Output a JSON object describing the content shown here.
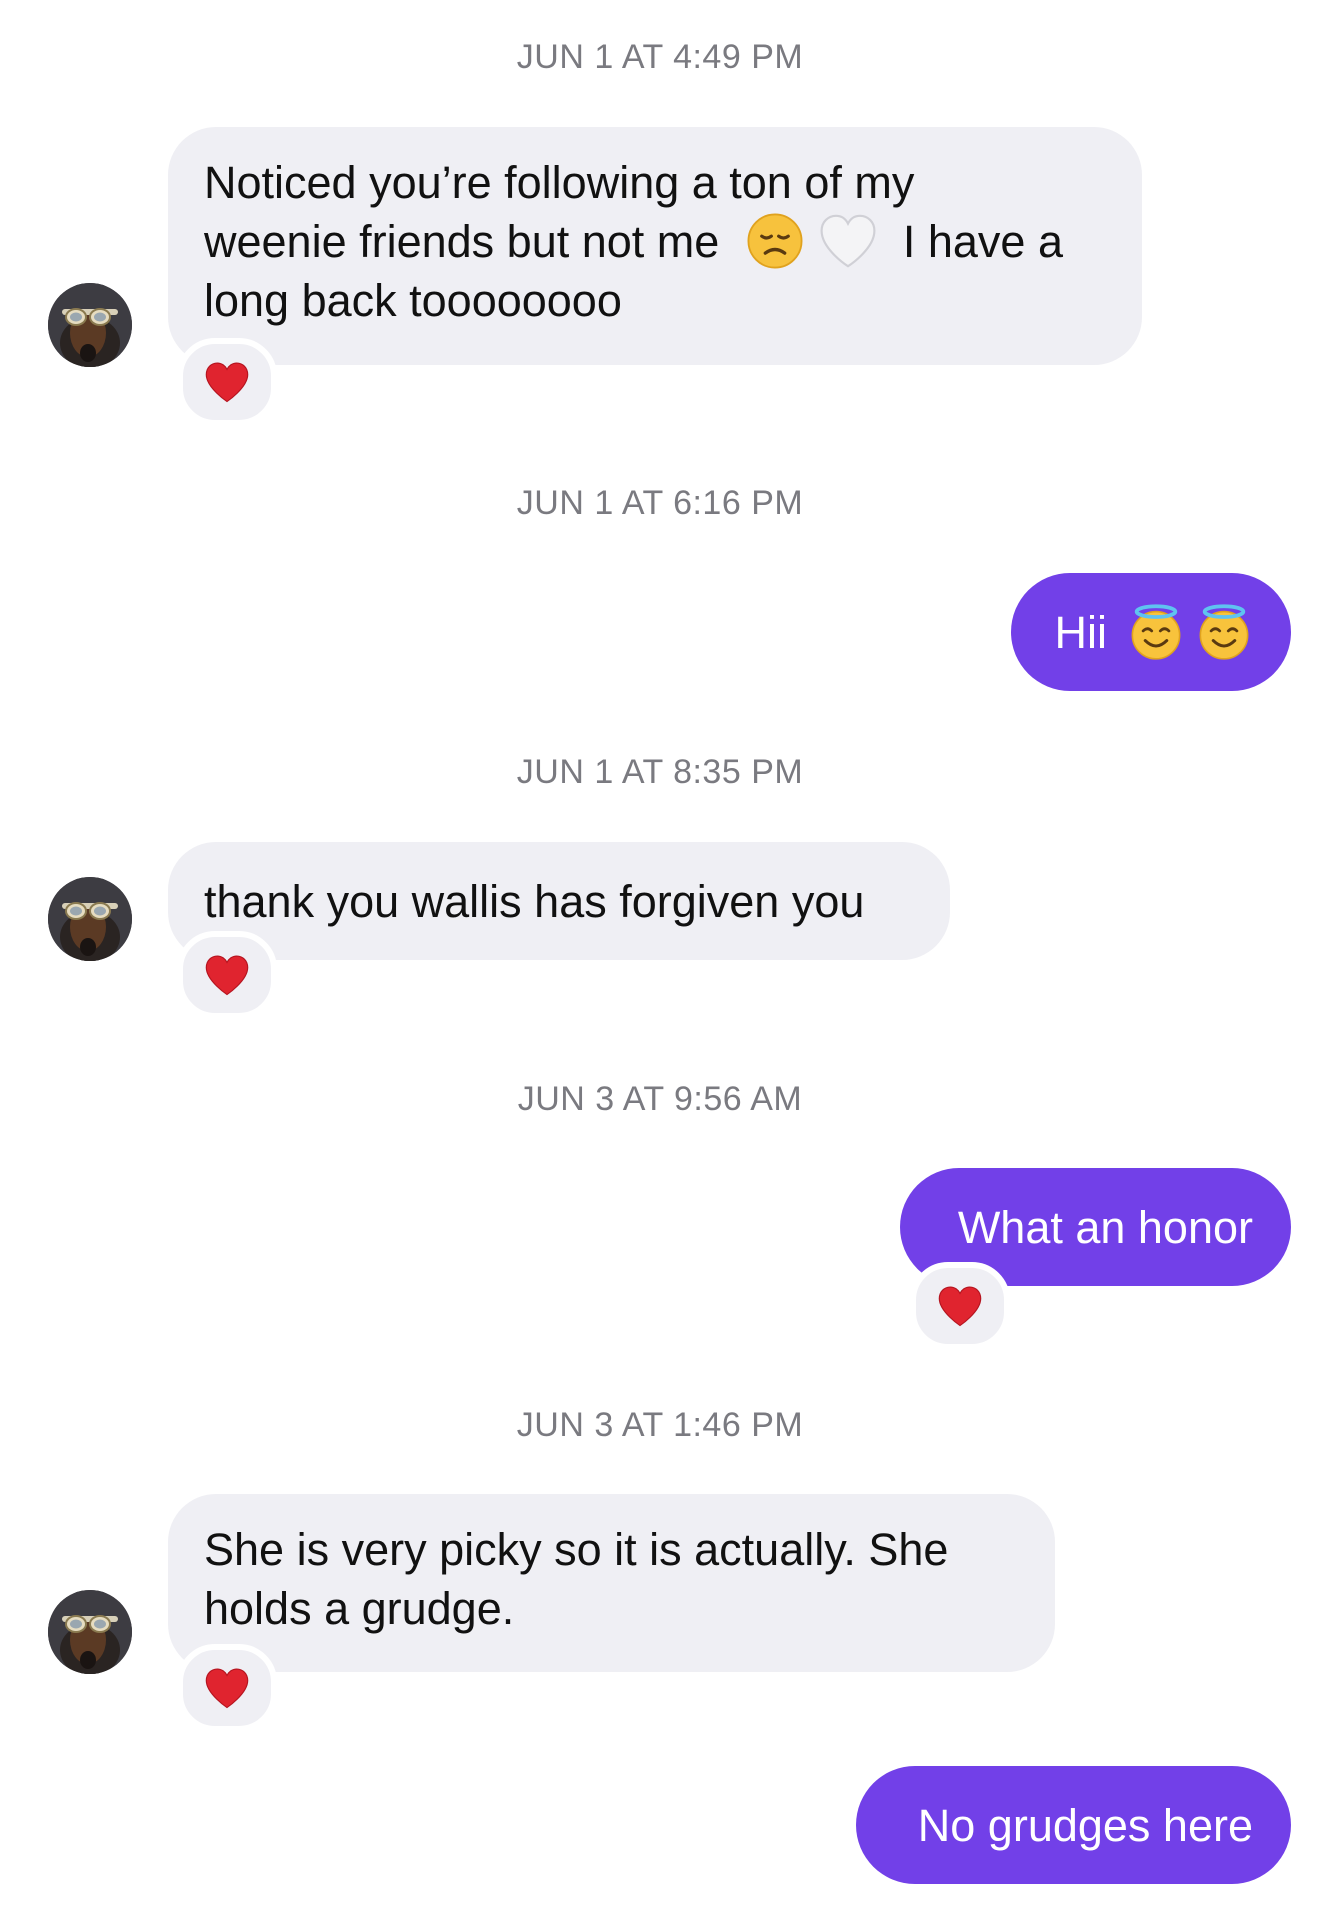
{
  "conversation": {
    "timestamps": [
      "JUN 1 AT 4:49 PM",
      "JUN 1 AT 6:16 PM",
      "JUN 1 AT 8:35 PM",
      "JUN 3 AT 9:56 AM",
      "JUN 3 AT 1:46 PM"
    ],
    "messages": [
      {
        "sender": "them",
        "lines": [
          "Noticed you’re following a ton of my",
          "weenie friends but not me",
          "I have a",
          "long back toooooooo"
        ],
        "emojis": [
          "disappointed-face",
          "white-heart"
        ],
        "reaction": "red-heart"
      },
      {
        "sender": "me",
        "text": "Hii",
        "emojis": [
          "smiling-face-with-halo",
          "smiling-face-with-halo"
        ]
      },
      {
        "sender": "them",
        "text": "thank you wallis has forgiven you",
        "reaction": "red-heart"
      },
      {
        "sender": "me",
        "text": "What an honor",
        "reaction": "red-heart"
      },
      {
        "sender": "them",
        "lines": [
          "She is very picky so it is actually. She",
          "holds a grudge."
        ],
        "reaction": "red-heart"
      },
      {
        "sender": "me",
        "text": "No grudges here"
      }
    ]
  },
  "colors": {
    "outgoing_bubble": "#7240e8",
    "incoming_bubble": "#efeff4",
    "timestamp": "#7a7a80",
    "reaction_heart": "#e0242f"
  }
}
